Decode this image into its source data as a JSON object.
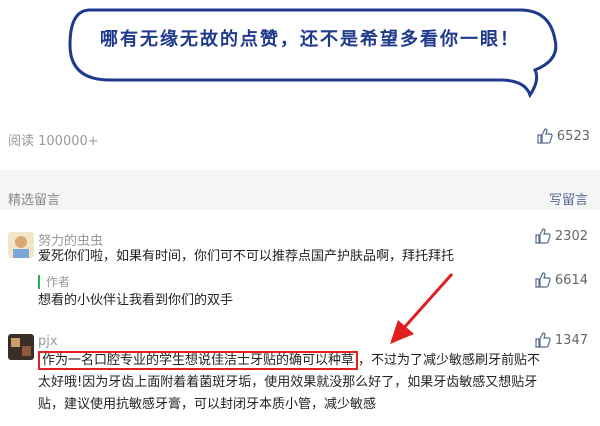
{
  "banner": {
    "text": "哪有无缘无故的点赞，还不是希望多看你一眼！"
  },
  "stats": {
    "read_label": "阅读 100000+",
    "like_count": "6523"
  },
  "section": {
    "title": "精选留言",
    "write_label": "写留言"
  },
  "comments": [
    {
      "nick": "努力的虫虫",
      "likes": "2302",
      "text": "爱死你们啦，如果有时间，你们可不可以推荐点国产护肤品啊，拜托拜托",
      "reply": {
        "label": "作者",
        "likes": "6614",
        "text": "想看的小伙伴让我看到你们的双手"
      }
    },
    {
      "nick": "pjx",
      "likes": "1347",
      "text_highlight": "作为一名口腔专业的学生想说佳洁士牙贴的确可以种草",
      "text_rest1": "，不过为了减少敏感刷牙前贴不",
      "text_line2": "太好哦!因为牙齿上面附着着菌斑牙垢，使用效果就没那么好了，如果牙齿敏感又想贴牙",
      "text_line3": "贴，建议使用抗敏感牙膏，可以封闭牙本质小管，减少敏感"
    }
  ],
  "colors": {
    "highlight": "#e02020",
    "link": "#576b95",
    "author_bar": "#2bb24c",
    "banner_text": "#1f3a8c"
  }
}
